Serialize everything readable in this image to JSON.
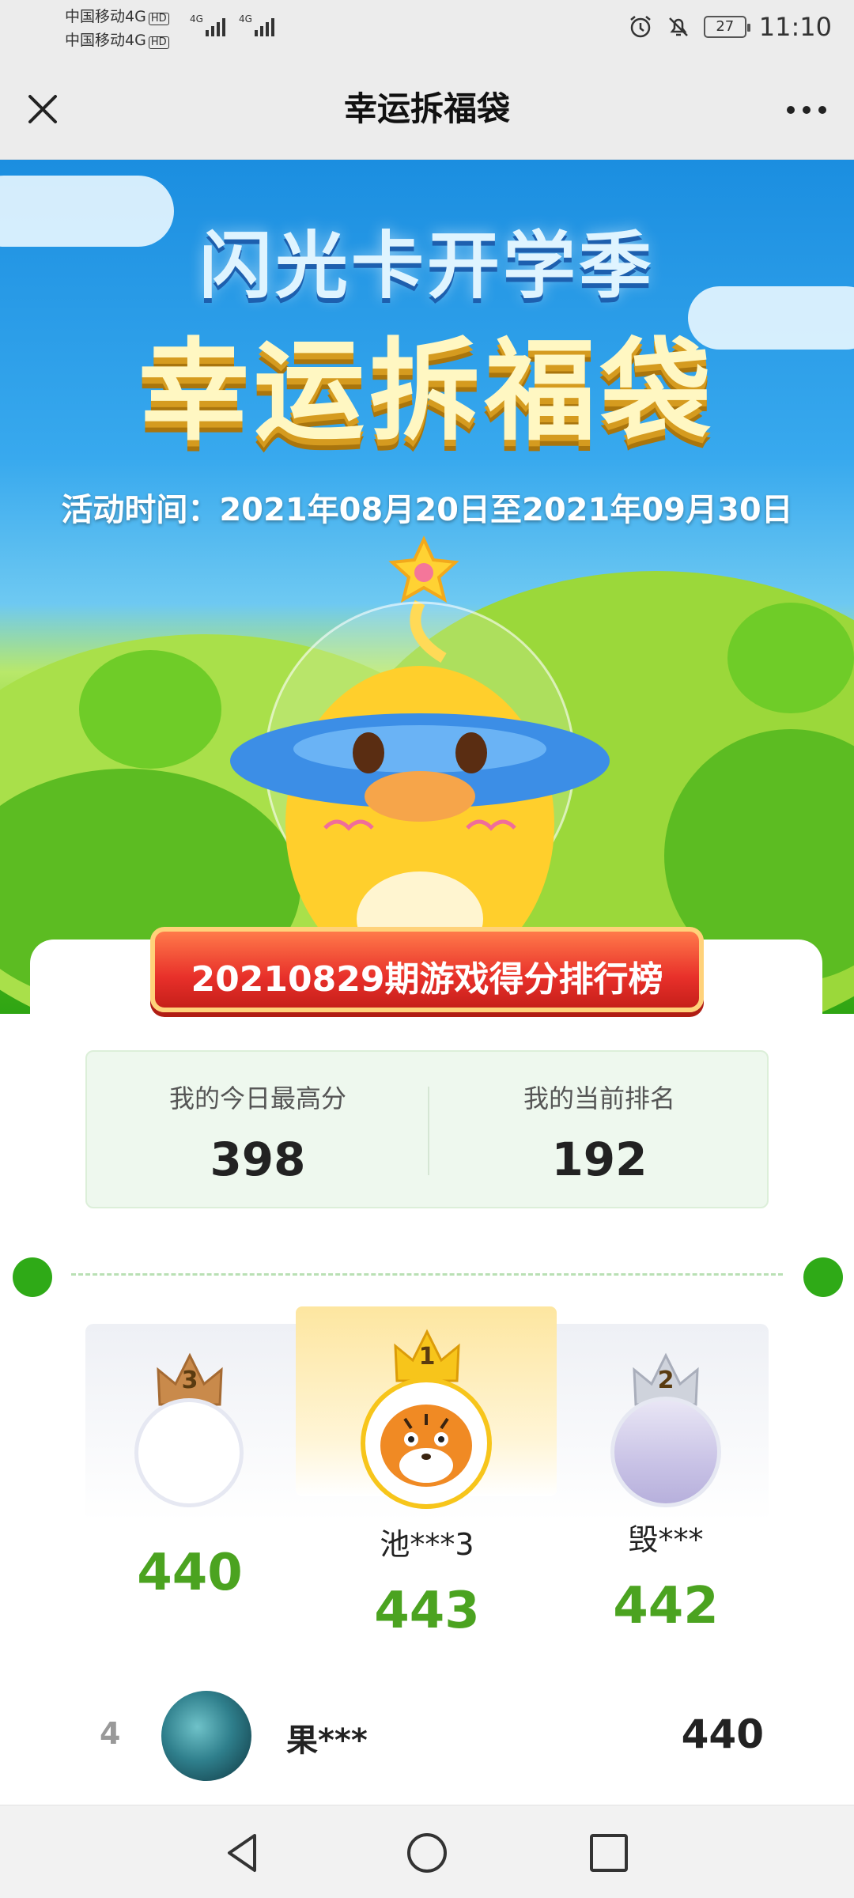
{
  "status_bar": {
    "carrier_1": "中国移动4G",
    "carrier_2": "中国移动4G",
    "hd_badge": "HD",
    "network_1": "4G",
    "network_2": "4G",
    "battery": "27",
    "time": "11:10"
  },
  "title_bar": {
    "title": "幸运拆福袋",
    "close_icon": "close-icon",
    "more_icon": "more-icon"
  },
  "hero": {
    "subtitle": "闪光卡开学季",
    "title": "幸运拆福袋",
    "period": "活动时间：2021年08月20日至2021年09月30日"
  },
  "leaderboard": {
    "banner": "20210829期游戏得分排行榜",
    "my_best_label": "我的今日最高分",
    "my_best_value": "398",
    "my_rank_label": "我的当前排名",
    "my_rank_value": "192",
    "podium": {
      "first": {
        "rank": "1",
        "name": "池***3",
        "score": "443"
      },
      "second": {
        "rank": "2",
        "name": "毁***",
        "score": "442"
      },
      "third": {
        "rank": "3",
        "name": "",
        "score": "440"
      }
    },
    "rows": [
      {
        "rank": "4",
        "name": "果***",
        "score": "440"
      }
    ]
  },
  "nav_bar": {
    "back_icon": "back-icon",
    "home_icon": "home-icon",
    "recents_icon": "recents-icon"
  },
  "colors": {
    "score_green": "#4ba320",
    "banner_red": "#e8302a",
    "sky_blue": "#38a9ee",
    "grass_green": "#7ecb2a"
  }
}
